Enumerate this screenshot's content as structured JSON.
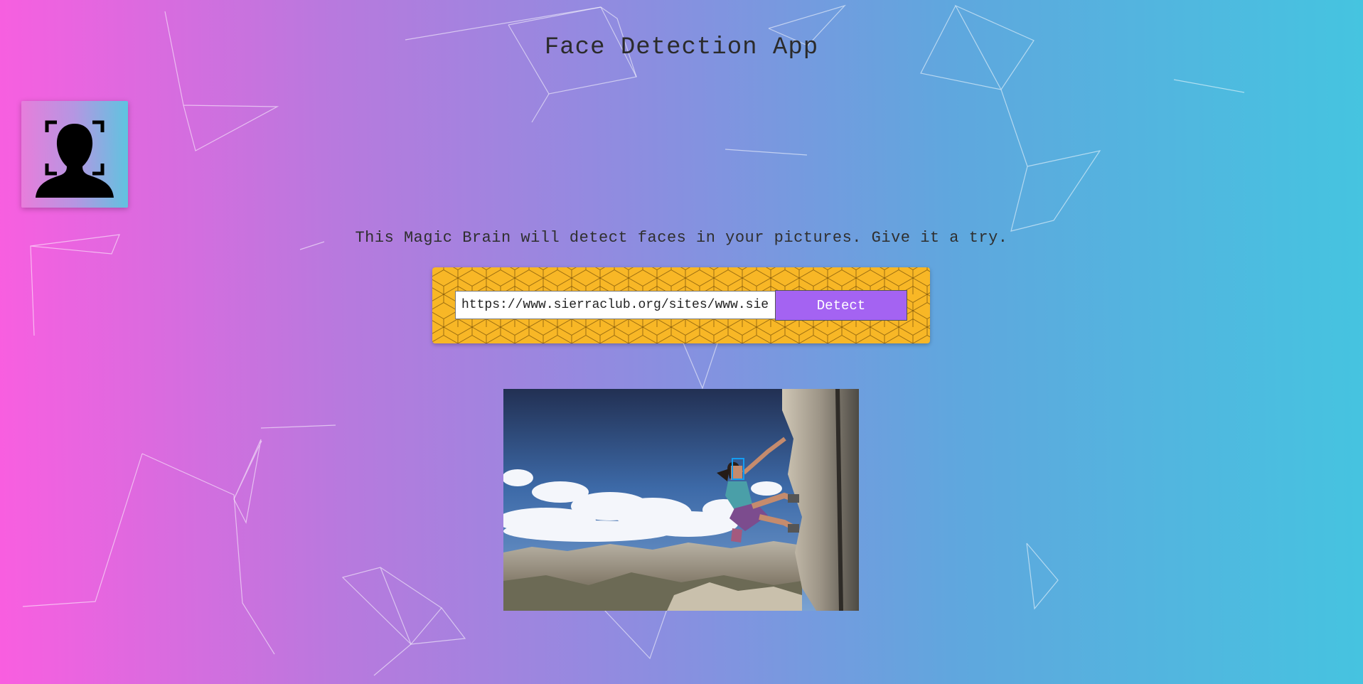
{
  "app": {
    "title": "Face Detection App",
    "logo_icon": "face-detect-icon"
  },
  "intro": {
    "text": "This Magic Brain will detect faces in your pictures. Give it a try."
  },
  "form": {
    "url_value": "https://www.sierraclub.org/sites/www.sierraclub.org/files/styles/flexslider_full/public/sierra/articles/big/SIERRA%20Rock%20Climber%20WB.jpg",
    "detect_label": "Detect"
  },
  "result": {
    "image_subject": "rock-climber-photo",
    "faces_detected": 1
  },
  "colors": {
    "gradient_left": "#f95ee0",
    "gradient_right": "#45c4e0",
    "form_background": "#f8b726",
    "button": "#a463f2",
    "face_box": "#149df2"
  }
}
